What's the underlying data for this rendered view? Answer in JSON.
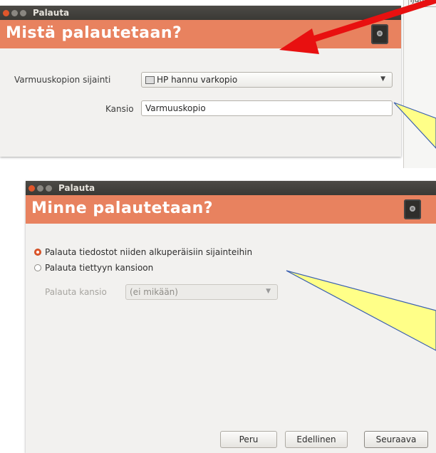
{
  "background_window": {
    "title": "Palauta",
    "heading": "Mistä palautetaan?",
    "backup_location_label": "Varmuuskopion sijainti",
    "backup_location_value": "HP hannu varkopio",
    "folder_label": "Kansio",
    "folder_value": "Varmuuskopio"
  },
  "corner_fragment_text": "ljautus",
  "front_window": {
    "title": "Palauta",
    "heading": "Minne palautetaan?",
    "radio_original": "Palauta tiedostot  niiden alkuperäisiin sijainteihin",
    "radio_original_selected": true,
    "radio_folder": "Palauta tiettyyn kansioon",
    "restore_folder_label": "Palauta kansio",
    "restore_folder_value": "(ei mikään)",
    "buttons": {
      "cancel": "Peru",
      "back": "Edellinen",
      "next": "Seuraava"
    }
  },
  "colors": {
    "banner": "#e8825f",
    "titlebar": "#3f3e3a",
    "arrow_red": "#e81010",
    "callout_yellow": "#ffff88"
  }
}
